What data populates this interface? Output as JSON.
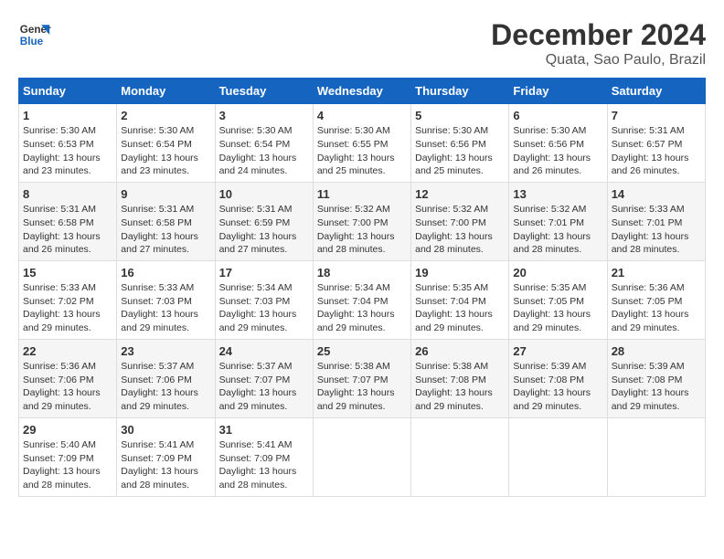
{
  "logo": {
    "line1": "General",
    "line2": "Blue"
  },
  "title": "December 2024",
  "subtitle": "Quata, Sao Paulo, Brazil",
  "days_of_week": [
    "Sunday",
    "Monday",
    "Tuesday",
    "Wednesday",
    "Thursday",
    "Friday",
    "Saturday"
  ],
  "weeks": [
    [
      {
        "day": "1",
        "info": "Sunrise: 5:30 AM\nSunset: 6:53 PM\nDaylight: 13 hours\nand 23 minutes."
      },
      {
        "day": "2",
        "info": "Sunrise: 5:30 AM\nSunset: 6:54 PM\nDaylight: 13 hours\nand 23 minutes."
      },
      {
        "day": "3",
        "info": "Sunrise: 5:30 AM\nSunset: 6:54 PM\nDaylight: 13 hours\nand 24 minutes."
      },
      {
        "day": "4",
        "info": "Sunrise: 5:30 AM\nSunset: 6:55 PM\nDaylight: 13 hours\nand 25 minutes."
      },
      {
        "day": "5",
        "info": "Sunrise: 5:30 AM\nSunset: 6:56 PM\nDaylight: 13 hours\nand 25 minutes."
      },
      {
        "day": "6",
        "info": "Sunrise: 5:30 AM\nSunset: 6:56 PM\nDaylight: 13 hours\nand 26 minutes."
      },
      {
        "day": "7",
        "info": "Sunrise: 5:31 AM\nSunset: 6:57 PM\nDaylight: 13 hours\nand 26 minutes."
      }
    ],
    [
      {
        "day": "8",
        "info": "Sunrise: 5:31 AM\nSunset: 6:58 PM\nDaylight: 13 hours\nand 26 minutes."
      },
      {
        "day": "9",
        "info": "Sunrise: 5:31 AM\nSunset: 6:58 PM\nDaylight: 13 hours\nand 27 minutes."
      },
      {
        "day": "10",
        "info": "Sunrise: 5:31 AM\nSunset: 6:59 PM\nDaylight: 13 hours\nand 27 minutes."
      },
      {
        "day": "11",
        "info": "Sunrise: 5:32 AM\nSunset: 7:00 PM\nDaylight: 13 hours\nand 28 minutes."
      },
      {
        "day": "12",
        "info": "Sunrise: 5:32 AM\nSunset: 7:00 PM\nDaylight: 13 hours\nand 28 minutes."
      },
      {
        "day": "13",
        "info": "Sunrise: 5:32 AM\nSunset: 7:01 PM\nDaylight: 13 hours\nand 28 minutes."
      },
      {
        "day": "14",
        "info": "Sunrise: 5:33 AM\nSunset: 7:01 PM\nDaylight: 13 hours\nand 28 minutes."
      }
    ],
    [
      {
        "day": "15",
        "info": "Sunrise: 5:33 AM\nSunset: 7:02 PM\nDaylight: 13 hours\nand 29 minutes."
      },
      {
        "day": "16",
        "info": "Sunrise: 5:33 AM\nSunset: 7:03 PM\nDaylight: 13 hours\nand 29 minutes."
      },
      {
        "day": "17",
        "info": "Sunrise: 5:34 AM\nSunset: 7:03 PM\nDaylight: 13 hours\nand 29 minutes."
      },
      {
        "day": "18",
        "info": "Sunrise: 5:34 AM\nSunset: 7:04 PM\nDaylight: 13 hours\nand 29 minutes."
      },
      {
        "day": "19",
        "info": "Sunrise: 5:35 AM\nSunset: 7:04 PM\nDaylight: 13 hours\nand 29 minutes."
      },
      {
        "day": "20",
        "info": "Sunrise: 5:35 AM\nSunset: 7:05 PM\nDaylight: 13 hours\nand 29 minutes."
      },
      {
        "day": "21",
        "info": "Sunrise: 5:36 AM\nSunset: 7:05 PM\nDaylight: 13 hours\nand 29 minutes."
      }
    ],
    [
      {
        "day": "22",
        "info": "Sunrise: 5:36 AM\nSunset: 7:06 PM\nDaylight: 13 hours\nand 29 minutes."
      },
      {
        "day": "23",
        "info": "Sunrise: 5:37 AM\nSunset: 7:06 PM\nDaylight: 13 hours\nand 29 minutes."
      },
      {
        "day": "24",
        "info": "Sunrise: 5:37 AM\nSunset: 7:07 PM\nDaylight: 13 hours\nand 29 minutes."
      },
      {
        "day": "25",
        "info": "Sunrise: 5:38 AM\nSunset: 7:07 PM\nDaylight: 13 hours\nand 29 minutes."
      },
      {
        "day": "26",
        "info": "Sunrise: 5:38 AM\nSunset: 7:08 PM\nDaylight: 13 hours\nand 29 minutes."
      },
      {
        "day": "27",
        "info": "Sunrise: 5:39 AM\nSunset: 7:08 PM\nDaylight: 13 hours\nand 29 minutes."
      },
      {
        "day": "28",
        "info": "Sunrise: 5:39 AM\nSunset: 7:08 PM\nDaylight: 13 hours\nand 29 minutes."
      }
    ],
    [
      {
        "day": "29",
        "info": "Sunrise: 5:40 AM\nSunset: 7:09 PM\nDaylight: 13 hours\nand 28 minutes."
      },
      {
        "day": "30",
        "info": "Sunrise: 5:41 AM\nSunset: 7:09 PM\nDaylight: 13 hours\nand 28 minutes."
      },
      {
        "day": "31",
        "info": "Sunrise: 5:41 AM\nSunset: 7:09 PM\nDaylight: 13 hours\nand 28 minutes."
      },
      {
        "day": "",
        "info": ""
      },
      {
        "day": "",
        "info": ""
      },
      {
        "day": "",
        "info": ""
      },
      {
        "day": "",
        "info": ""
      }
    ]
  ]
}
